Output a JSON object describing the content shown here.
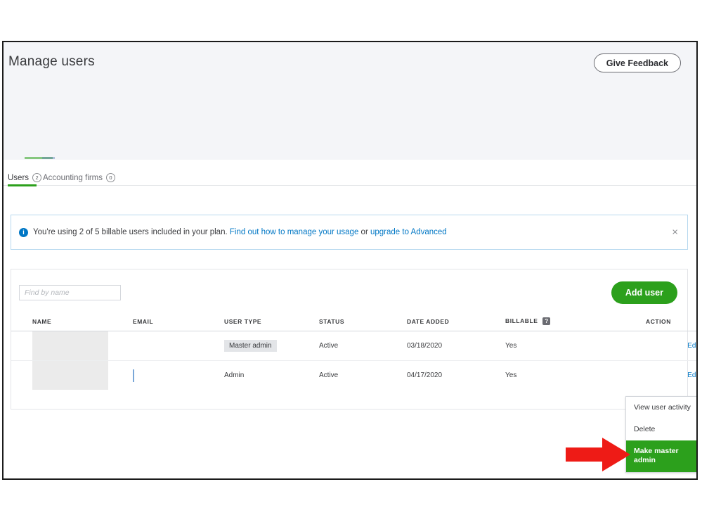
{
  "header": {
    "title": "Manage users",
    "feedback_label": "Give Feedback"
  },
  "tabs": [
    {
      "label": "Users",
      "badge": "2",
      "active": true
    },
    {
      "label": "Accounting firms",
      "badge": "0",
      "active": false
    }
  ],
  "banner": {
    "icon": "info-icon",
    "text_before": "You're using 2 of 5 billable users included in your plan.",
    "link1": "Find out how to manage your usage",
    "separator": "or",
    "link2": "upgrade to Advanced",
    "close_label": "×"
  },
  "toolbar": {
    "search_placeholder": "Find by name",
    "search_value": "",
    "add_user_label": "Add user"
  },
  "table": {
    "columns": [
      "NAME",
      "EMAIL",
      "USER TYPE",
      "STATUS",
      "DATE ADDED",
      "BILLABLE",
      "ACTION"
    ],
    "billable_help": "?",
    "rows": [
      {
        "name": "",
        "email": "",
        "user_type": "Master admin",
        "status": "Active",
        "date_added": "03/18/2020",
        "billable": "Yes",
        "action": "Edit"
      },
      {
        "name": "",
        "email": "",
        "user_type": "Admin",
        "status": "Active",
        "date_added": "04/17/2020",
        "billable": "Yes",
        "action": "Edit"
      }
    ]
  },
  "action_menu": {
    "items": [
      {
        "label": "View user activity",
        "highlight": false
      },
      {
        "label": "Delete",
        "highlight": false
      },
      {
        "label": "Make master admin",
        "highlight": true
      }
    ]
  },
  "colors": {
    "brand_green": "#2ca01c",
    "link_blue": "#0077c5",
    "info_blue": "#0077c5",
    "arrow_red": "#ee1b16",
    "text_dark": "#393a3d",
    "header_bg": "#f4f5f8"
  }
}
